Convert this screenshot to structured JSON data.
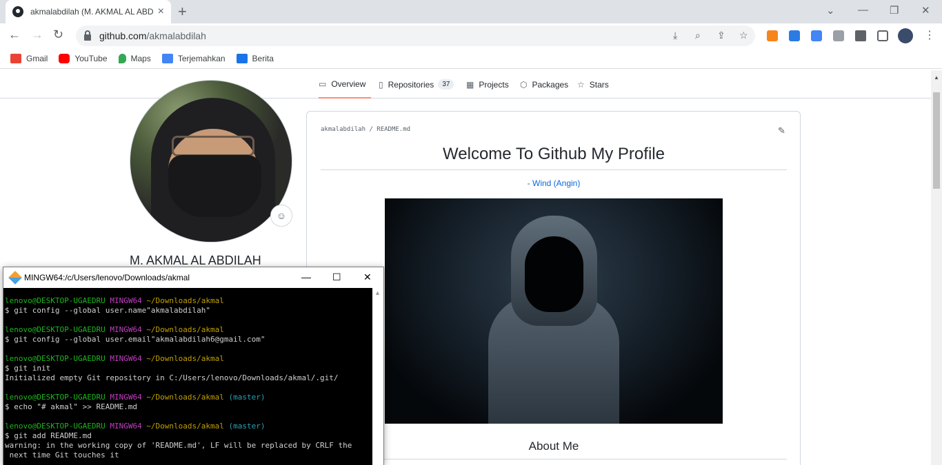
{
  "browser": {
    "tab_title": "akmalabdilah (M. AKMAL AL ABDILAH)",
    "tab_close": "×",
    "new_tab": "+",
    "url_host": "github.com",
    "url_path": "/akmalabdilah",
    "window_controls": {
      "chevron": "⌄",
      "minimize": "—",
      "restore": "❐",
      "close": "✕"
    },
    "bookmarks": [
      {
        "label": "Gmail",
        "color": "#ea4335"
      },
      {
        "label": "YouTube",
        "color": "#ff0000"
      },
      {
        "label": "Maps",
        "color": "#34a853"
      },
      {
        "label": "Terjemahkan",
        "color": "#4285f4"
      },
      {
        "label": "Berita",
        "color": "#1a73e8"
      }
    ]
  },
  "github": {
    "nav": [
      {
        "label": "Overview",
        "icon": "book-icon"
      },
      {
        "label": "Repositories",
        "icon": "repo-icon",
        "count": "37"
      },
      {
        "label": "Projects",
        "icon": "project-icon"
      },
      {
        "label": "Packages",
        "icon": "package-icon"
      },
      {
        "label": "Stars",
        "icon": "star-icon"
      }
    ],
    "profile_name": "M. AKMAL AL ABDILAH",
    "readme": {
      "path_user": "akmalabdilah",
      "path_sep": "/",
      "path_file": "README.md",
      "heading": "Welcome To Github My Profile",
      "quote": "- Wind (Angin)",
      "section": "About Me"
    }
  },
  "terminal": {
    "title": "MINGW64:/c/Users/lenovo/Downloads/akmal",
    "user": "lenovo@DESKTOP-UGAEDRU",
    "env": "MINGW64",
    "path": "~/Downloads/akmal",
    "branch": "(master)",
    "cmd1": "$ git config --global user.name\"akmalabdilah\"",
    "cmd2": "$ git config --global user.email\"akmalabdilah6@gmail.com\"",
    "cmd3": "$ git init",
    "out3": "Initialized empty Git repository in C:/Users/lenovo/Downloads/akmal/.git/",
    "cmd4": "$ echo \"# akmal\" >> README.md",
    "cmd5": "$ git add README.md",
    "out5a": "warning: in the working copy of 'README.md', LF will be replaced by CRLF the",
    "out5b": " next time Git touches it"
  }
}
